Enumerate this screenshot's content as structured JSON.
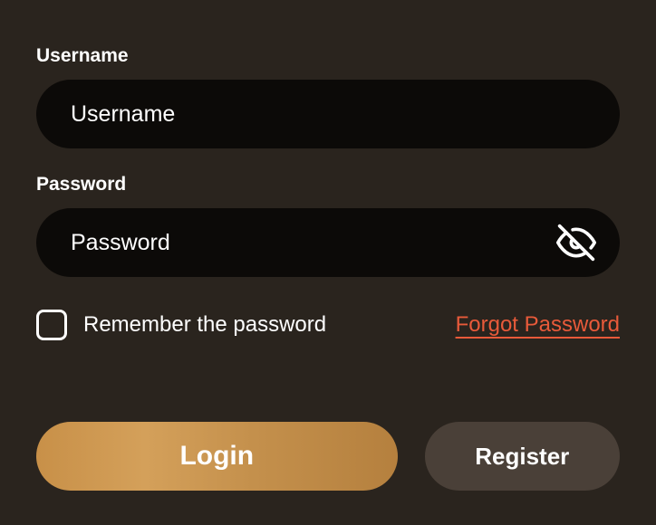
{
  "username": {
    "label": "Username",
    "placeholder": "Username"
  },
  "password": {
    "label": "Password",
    "placeholder": "Password"
  },
  "remember": {
    "label": "Remember the password"
  },
  "forgot": {
    "label": "Forgot Password"
  },
  "buttons": {
    "login": "Login",
    "register": "Register"
  }
}
